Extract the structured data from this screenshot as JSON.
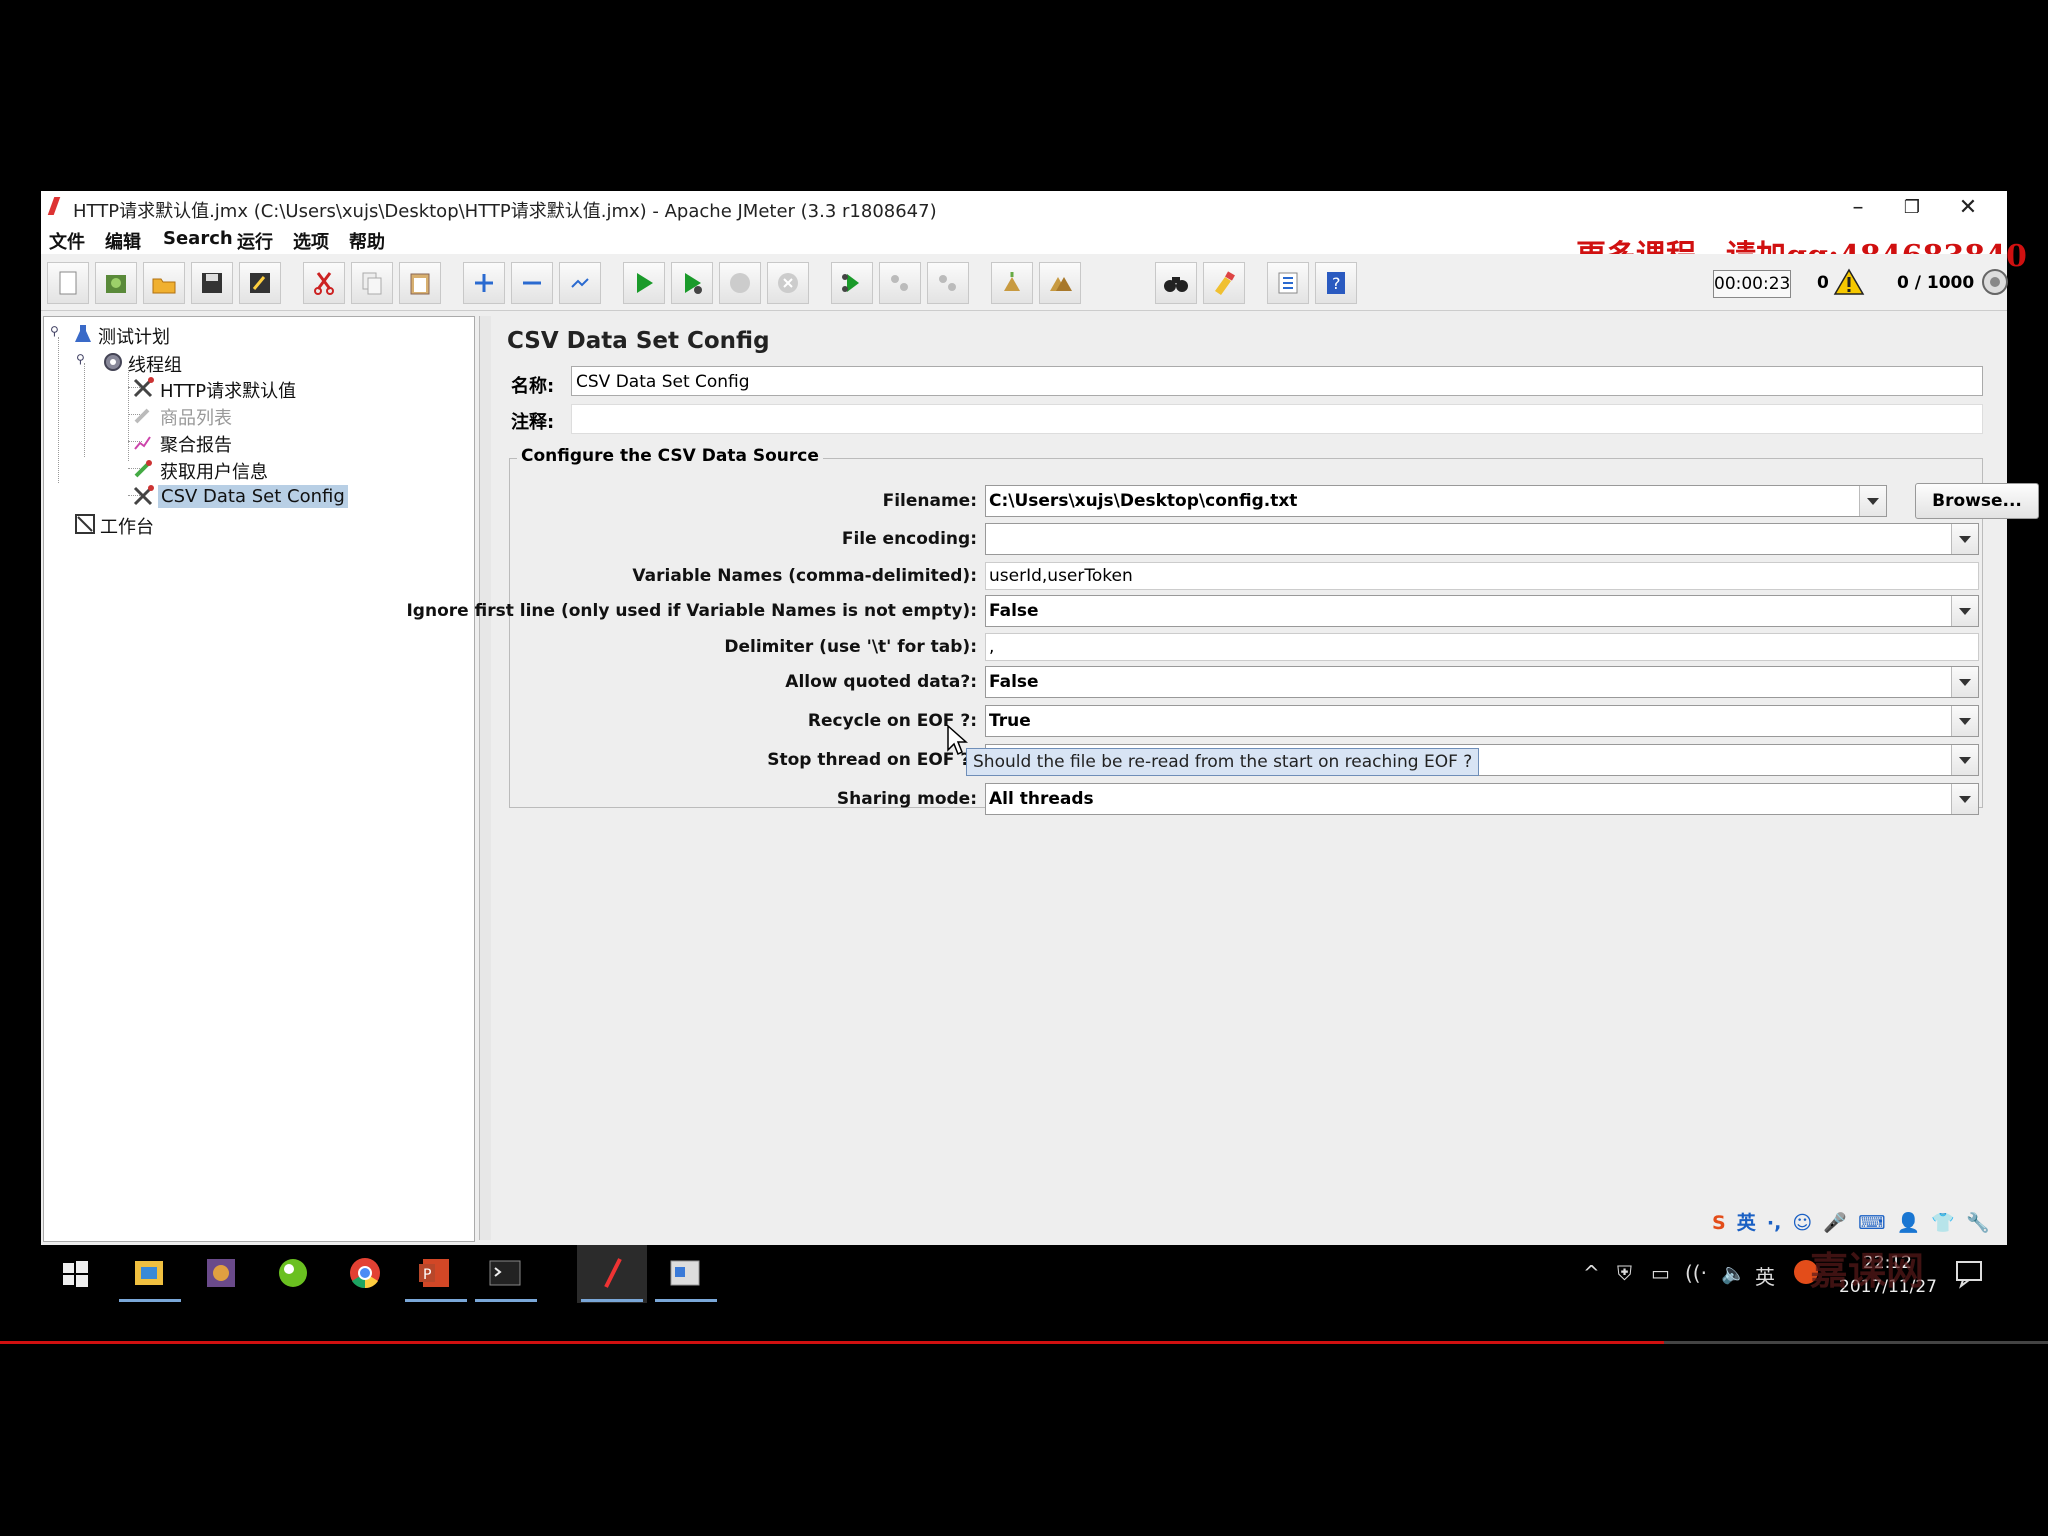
{
  "window": {
    "title": "HTTP请求默认值.jmx (C:\\Users\\xujs\\Desktop\\HTTP请求默认值.jmx) - Apache JMeter (3.3 r1808647)",
    "controls": {
      "minimize": "–",
      "restore": "❐",
      "close": "✕"
    }
  },
  "menu": [
    "文件",
    "编辑",
    "Search",
    "运行",
    "选项",
    "帮助"
  ],
  "promo": "更多课程，请加qq:484683840",
  "toolbar": {
    "buttons": [
      "new-icon",
      "templates-icon",
      "open-icon",
      "save-icon",
      "save-as-icon",
      "cut-icon",
      "copy-icon",
      "paste-icon",
      "expand-icon",
      "collapse-icon",
      "toggle-icon",
      "start-icon",
      "start-no-pause-icon",
      "stop-icon",
      "shutdown-icon",
      "remote-start-icon",
      "remote-stop-icon",
      "remote-shutdown-icon",
      "clear-icon",
      "clear-all-icon",
      "search-icon",
      "reset-search-icon",
      "function-helper-icon",
      "help-icon"
    ],
    "elapsed": "00:00:23",
    "errors": "0",
    "threads": "0 / 1000"
  },
  "tree": {
    "items": [
      {
        "label": "测试计划"
      },
      {
        "label": "线程组"
      },
      {
        "label": "HTTP请求默认值"
      },
      {
        "label": "商品列表"
      },
      {
        "label": "聚合报告"
      },
      {
        "label": "获取用户信息"
      },
      {
        "label": "CSV Data Set Config"
      },
      {
        "label": "工作台"
      }
    ]
  },
  "panel": {
    "title": "CSV Data Set Config",
    "name_label": "名称:",
    "name_value": "CSV Data Set Config",
    "comment_label": "注释:",
    "fieldset_legend": "Configure the CSV Data Source",
    "browse_label": "Browse...",
    "fields": [
      {
        "label": "Filename:",
        "value": "C:\\Users\\xujs\\Desktop\\config.txt"
      },
      {
        "label": "File encoding:",
        "value": ""
      },
      {
        "label": "Variable Names (comma-delimited):",
        "value": "userId,userToken"
      },
      {
        "label": "Ignore first line (only used if Variable Names is not empty):",
        "value": "False"
      },
      {
        "label": "Delimiter (use '\\t' for tab):",
        "value": ","
      },
      {
        "label": "Allow quoted data?:",
        "value": "False"
      },
      {
        "label": "Recycle on EOF ?:",
        "value": "True"
      },
      {
        "label": "Stop thread on EOF ?:",
        "value": ""
      },
      {
        "label": "Sharing mode:",
        "value": "All threads"
      }
    ],
    "tooltip": "Should the file be re-read from the start on reaching EOF ?"
  },
  "ime": [
    "S",
    "英",
    "·,",
    "☺",
    "🎤",
    "⌨",
    "👤",
    "👕",
    "🔧"
  ],
  "taskbar": {
    "tray": [
      "^",
      "⛨",
      "▭",
      "((·",
      "🔈",
      "英"
    ],
    "clock_time": "22:12",
    "clock_date": "2017/11/27"
  },
  "watermark": "嘉课网",
  "colors": {
    "promo": "#d01010",
    "selection": "#b8cfe5",
    "tooltip_bg": "#d8e4f4"
  }
}
